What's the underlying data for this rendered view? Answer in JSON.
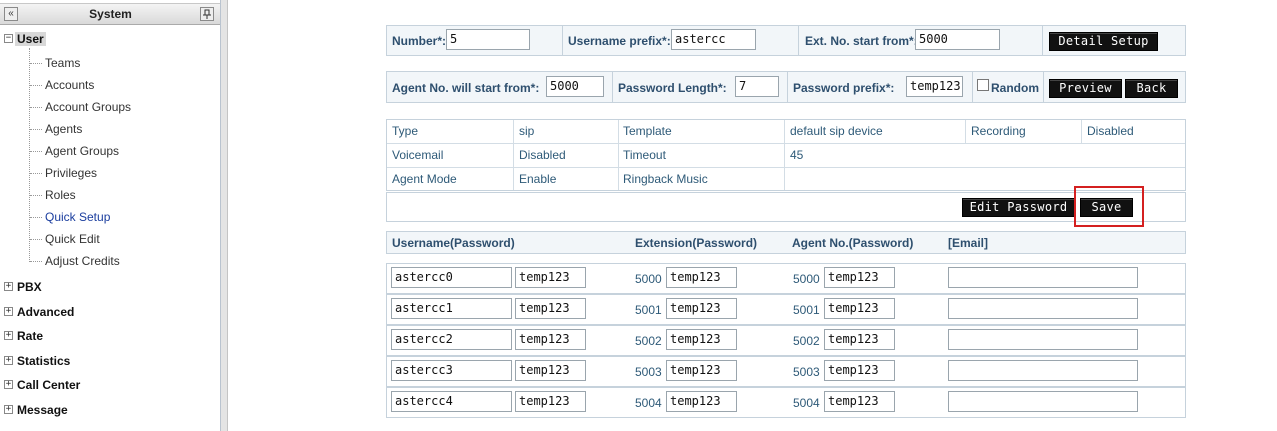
{
  "sidebar": {
    "title": "System",
    "collapse_icon": "«",
    "pin_icon": "pin",
    "user_group": "User",
    "user_items": [
      "Teams",
      "Accounts",
      "Account Groups",
      "Agents",
      "Agent Groups",
      "Privileges",
      "Roles",
      "Quick Setup",
      "Quick Edit",
      "Adjust Credits"
    ],
    "active_item": "Quick Setup",
    "groups": [
      "PBX",
      "Advanced",
      "Rate",
      "Statistics",
      "Call Center",
      "Message"
    ]
  },
  "form": {
    "number_label": "Number*:",
    "number_value": "5",
    "username_prefix_label": "Username prefix*:",
    "username_prefix_value": "astercc",
    "ext_start_label": "Ext. No. start from*:",
    "ext_start_value": "5000",
    "detail_setup_button": "Detail Setup",
    "agent_start_label": "Agent No. will start from*:",
    "agent_start_value": "5000",
    "password_length_label": "Password Length*:",
    "password_length_value": "7",
    "password_prefix_label": "Password prefix*:",
    "password_prefix_value": "temp123",
    "random_label": "Random",
    "random_checked": false,
    "preview_button": "Preview",
    "back_button": "Back"
  },
  "info": {
    "row1": [
      "Type",
      "sip",
      "Template",
      "default sip device",
      "Recording",
      "Disabled"
    ],
    "row2": [
      "Voicemail",
      "Disabled",
      "Timeout",
      "45"
    ],
    "row3": [
      "Agent Mode",
      "Enable",
      "Ringback Music"
    ]
  },
  "actions": {
    "edit_password_button": "Edit Password",
    "save_button": "Save"
  },
  "users_table": {
    "headers": [
      "Username(Password)",
      "Extension(Password)",
      "Agent No.(Password)",
      "[Email]"
    ],
    "rows": [
      {
        "username": "astercc0",
        "user_password": "temp123",
        "extension": "5000",
        "ext_password": "temp123",
        "agent_no": "5000",
        "agent_password": "temp123",
        "email": ""
      },
      {
        "username": "astercc1",
        "user_password": "temp123",
        "extension": "5001",
        "ext_password": "temp123",
        "agent_no": "5001",
        "agent_password": "temp123",
        "email": ""
      },
      {
        "username": "astercc2",
        "user_password": "temp123",
        "extension": "5002",
        "ext_password": "temp123",
        "agent_no": "5002",
        "agent_password": "temp123",
        "email": ""
      },
      {
        "username": "astercc3",
        "user_password": "temp123",
        "extension": "5003",
        "ext_password": "temp123",
        "agent_no": "5003",
        "agent_password": "temp123",
        "email": ""
      },
      {
        "username": "astercc4",
        "user_password": "temp123",
        "extension": "5004",
        "ext_password": "temp123",
        "agent_no": "5004",
        "agent_password": "temp123",
        "email": ""
      }
    ]
  },
  "colors": {
    "label": "#2e4f6e",
    "value": "#2e5a78",
    "active_link": "#1a3d9e",
    "highlight": "#d42020",
    "button_bg": "#111111"
  }
}
